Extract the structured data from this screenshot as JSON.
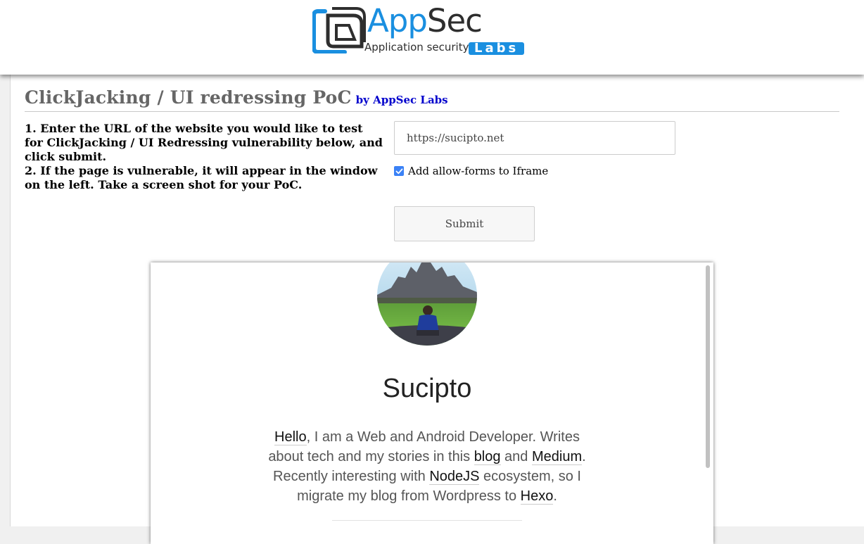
{
  "header": {
    "logo_app": "App",
    "logo_sec": "Sec",
    "logo_tagline": "Application security",
    "logo_labs": "Labs"
  },
  "main": {
    "title": "ClickJacking / UI redressing PoC",
    "byline": "by AppSec Labs",
    "instructions": [
      "1. Enter the URL of the website you would like to test for ClickJacking / UI Redressing vulnerability below, and click submit.",
      "2. If the page is vulnerable, it will appear in the window on the left. Take a screen shot for your PoC."
    ],
    "url_value": "https://sucipto.net",
    "allow_forms_label": "Add allow-forms to Iframe",
    "allow_forms_checked": true,
    "submit_label": "Submit"
  },
  "iframe": {
    "site_name": "Sucipto",
    "bio": {
      "w1": "Hello",
      "t1": ", I am a Web and Android Developer. Writes about tech and my stories in this ",
      "w2": "blog",
      "t2": " and ",
      "w3": "Medium",
      "t3": ". Recently interesting with ",
      "w4": "NodeJS",
      "t4": " ecosystem, so I migrate my blog from Wordpress to ",
      "w5": "Hexo",
      "t5": "."
    }
  },
  "colors": {
    "brand_blue": "#1a8fe0",
    "byline_blue": "#0000cc",
    "title_gray": "#666666",
    "checkbox_blue": "#3b82f6"
  }
}
